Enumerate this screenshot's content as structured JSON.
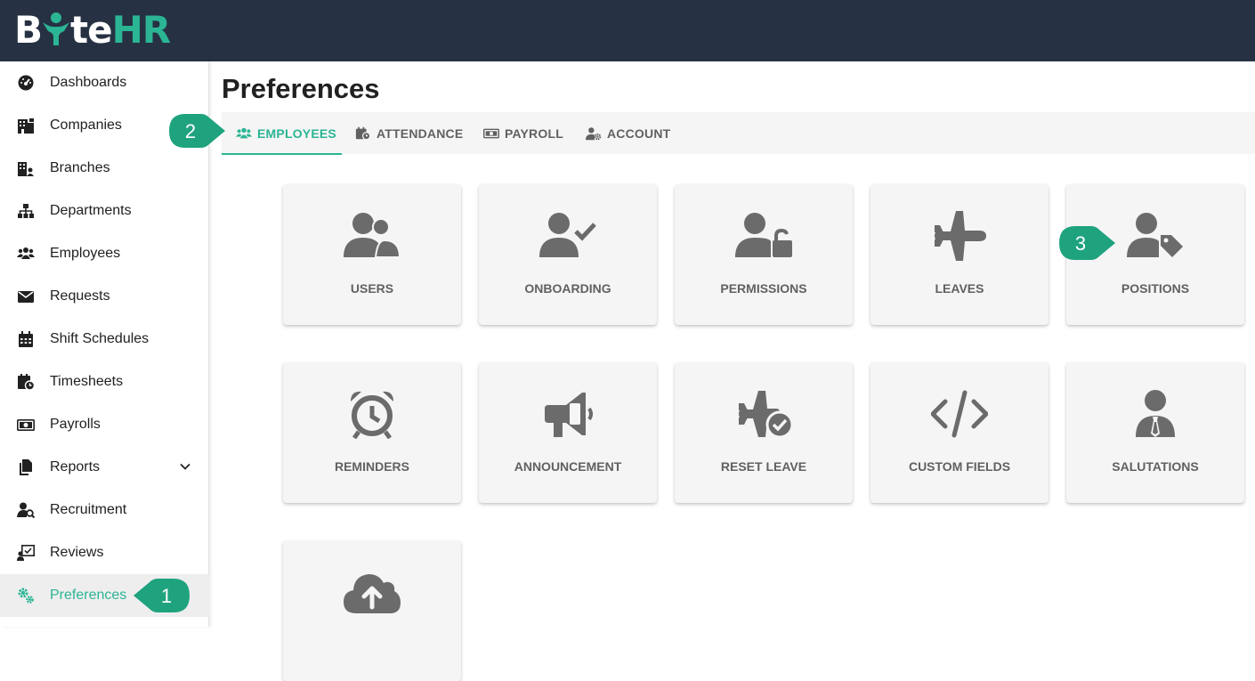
{
  "brand": {
    "logo_part1": "B",
    "logo_part2": "te",
    "logo_part3": "HR"
  },
  "sidebar": {
    "items": [
      {
        "label": "Dashboards",
        "icon": "tachometer-icon"
      },
      {
        "label": "Companies",
        "icon": "building-icon"
      },
      {
        "label": "Branches",
        "icon": "branches-icon"
      },
      {
        "label": "Departments",
        "icon": "sitemap-icon"
      },
      {
        "label": "Employees",
        "icon": "users-icon"
      },
      {
        "label": "Requests",
        "icon": "envelope-icon"
      },
      {
        "label": "Shift Schedules",
        "icon": "calendar-icon"
      },
      {
        "label": "Timesheets",
        "icon": "calendar-clock-icon"
      },
      {
        "label": "Payrolls",
        "icon": "money-icon"
      },
      {
        "label": "Reports",
        "icon": "copy-icon"
      },
      {
        "label": "Recruitment",
        "icon": "user-search-icon"
      },
      {
        "label": "Reviews",
        "icon": "review-board-icon"
      },
      {
        "label": "Preferences",
        "icon": "cogs-icon",
        "active": true
      }
    ]
  },
  "page": {
    "title": "Preferences"
  },
  "tabs": [
    {
      "label": "EMPLOYEES",
      "active": true
    },
    {
      "label": "ATTENDANCE"
    },
    {
      "label": "PAYROLL"
    },
    {
      "label": "ACCOUNT"
    }
  ],
  "cards": [
    {
      "label": "USERS",
      "icon": "users-icon"
    },
    {
      "label": "ONBOARDING",
      "icon": "user-check-icon"
    },
    {
      "label": "PERMISSIONS",
      "icon": "user-lock-icon"
    },
    {
      "label": "LEAVES",
      "icon": "plane-icon"
    },
    {
      "label": "POSITIONS",
      "icon": "user-tag-icon"
    },
    {
      "label": "REMINDERS",
      "icon": "alarm-clock-icon"
    },
    {
      "label": "ANNOUNCEMENT",
      "icon": "megaphone-icon"
    },
    {
      "label": "RESET LEAVE",
      "icon": "plane-check-icon"
    },
    {
      "label": "CUSTOM FIELDS",
      "icon": "code-icon"
    },
    {
      "label": "SALUTATIONS",
      "icon": "user-tie-icon"
    },
    {
      "label": "",
      "icon": "cloud-upload-icon"
    }
  ],
  "step_badges": [
    "1",
    "2",
    "3"
  ],
  "colors": {
    "topbar": "#263143",
    "accent": "#2bb594",
    "icon_gray": "#6b6b6b",
    "card_bg": "#f5f5f5"
  }
}
